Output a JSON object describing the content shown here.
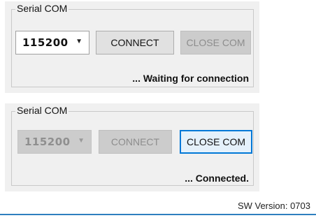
{
  "panels": [
    {
      "group_title": "Serial COM",
      "baud_rate": "115200",
      "combo_enabled": true,
      "connect_label": "CONNECT",
      "connect_enabled": true,
      "close_label": "CLOSE COM",
      "close_enabled": false,
      "status": "... Waiting for connection"
    },
    {
      "group_title": "Serial COM",
      "baud_rate": "115200",
      "combo_enabled": false,
      "connect_label": "CONNECT",
      "connect_enabled": false,
      "close_label": "CLOSE COM",
      "close_enabled": true,
      "status": "... Connected."
    }
  ],
  "footer": {
    "version": "SW Version: 0703"
  },
  "icons": {
    "dropdown": "chevron-down-icon",
    "dropdown_glyph": "▼"
  },
  "colors": {
    "focus_border": "#0078d7",
    "disabled_bg": "#cccccc",
    "bottom_line": "#2e7fbf"
  }
}
